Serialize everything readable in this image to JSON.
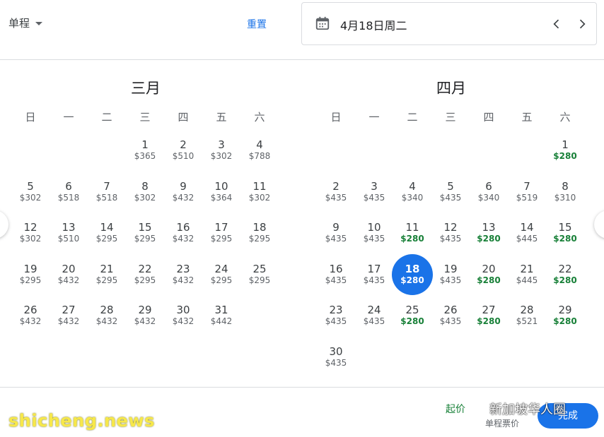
{
  "header": {
    "trip_type": "单程",
    "reset_label": "重置",
    "selected_date": "4月18日周二"
  },
  "weekdays": [
    "日",
    "一",
    "二",
    "三",
    "四",
    "五",
    "六"
  ],
  "months": [
    {
      "title": "三月",
      "leading_blanks": 3,
      "days": [
        {
          "d": "1",
          "p": "$365"
        },
        {
          "d": "2",
          "p": "$510"
        },
        {
          "d": "3",
          "p": "$302"
        },
        {
          "d": "4",
          "p": "$788"
        },
        {
          "d": "5",
          "p": "$302"
        },
        {
          "d": "6",
          "p": "$518"
        },
        {
          "d": "7",
          "p": "$518"
        },
        {
          "d": "8",
          "p": "$302"
        },
        {
          "d": "9",
          "p": "$432"
        },
        {
          "d": "10",
          "p": "$364"
        },
        {
          "d": "11",
          "p": "$302"
        },
        {
          "d": "12",
          "p": "$302"
        },
        {
          "d": "13",
          "p": "$510"
        },
        {
          "d": "14",
          "p": "$295"
        },
        {
          "d": "15",
          "p": "$295"
        },
        {
          "d": "16",
          "p": "$432"
        },
        {
          "d": "17",
          "p": "$295"
        },
        {
          "d": "18",
          "p": "$295"
        },
        {
          "d": "19",
          "p": "$295"
        },
        {
          "d": "20",
          "p": "$432"
        },
        {
          "d": "21",
          "p": "$295"
        },
        {
          "d": "22",
          "p": "$295"
        },
        {
          "d": "23",
          "p": "$432"
        },
        {
          "d": "24",
          "p": "$295"
        },
        {
          "d": "25",
          "p": "$295"
        },
        {
          "d": "26",
          "p": "$432"
        },
        {
          "d": "27",
          "p": "$432"
        },
        {
          "d": "28",
          "p": "$432"
        },
        {
          "d": "29",
          "p": "$432"
        },
        {
          "d": "30",
          "p": "$432"
        },
        {
          "d": "31",
          "p": "$442"
        }
      ]
    },
    {
      "title": "四月",
      "leading_blanks": 6,
      "days": [
        {
          "d": "1",
          "p": "$280",
          "low": true
        },
        {
          "d": "2",
          "p": "$435"
        },
        {
          "d": "3",
          "p": "$435"
        },
        {
          "d": "4",
          "p": "$340"
        },
        {
          "d": "5",
          "p": "$435"
        },
        {
          "d": "6",
          "p": "$340"
        },
        {
          "d": "7",
          "p": "$519"
        },
        {
          "d": "8",
          "p": "$310"
        },
        {
          "d": "9",
          "p": "$435"
        },
        {
          "d": "10",
          "p": "$435"
        },
        {
          "d": "11",
          "p": "$280",
          "low": true
        },
        {
          "d": "12",
          "p": "$435"
        },
        {
          "d": "13",
          "p": "$280",
          "low": true
        },
        {
          "d": "14",
          "p": "$445"
        },
        {
          "d": "15",
          "p": "$280",
          "low": true
        },
        {
          "d": "16",
          "p": "$435"
        },
        {
          "d": "17",
          "p": "$435"
        },
        {
          "d": "18",
          "p": "$280",
          "selected": true
        },
        {
          "d": "19",
          "p": "$435"
        },
        {
          "d": "20",
          "p": "$280",
          "low": true
        },
        {
          "d": "21",
          "p": "$445"
        },
        {
          "d": "22",
          "p": "$280",
          "low": true
        },
        {
          "d": "23",
          "p": "$435"
        },
        {
          "d": "24",
          "p": "$435"
        },
        {
          "d": "25",
          "p": "$280",
          "low": true
        },
        {
          "d": "26",
          "p": "$435"
        },
        {
          "d": "27",
          "p": "$280",
          "low": true
        },
        {
          "d": "28",
          "p": "$521"
        },
        {
          "d": "29",
          "p": "$280",
          "low": true
        },
        {
          "d": "30",
          "p": "$435"
        }
      ]
    }
  ],
  "footer": {
    "from_price": "起价",
    "oneway_label": "单程票价",
    "done_label": "完成"
  },
  "watermark": {
    "site": "shicheng.news",
    "group": "新加坡华人圈"
  },
  "colors": {
    "accent": "#1a73e8",
    "low_price": "#188038",
    "watermark_site": "#f7e84a"
  }
}
